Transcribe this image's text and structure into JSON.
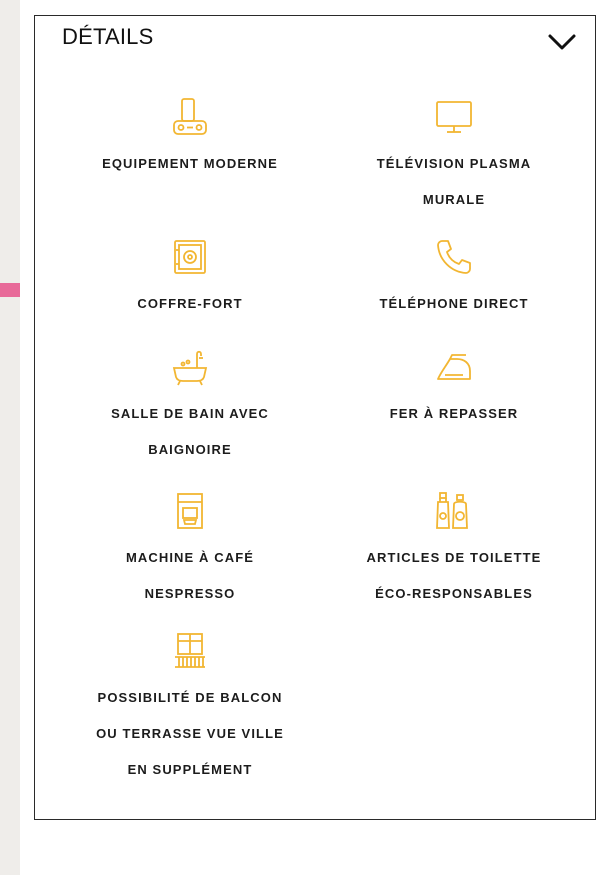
{
  "details": {
    "title": "DÉTAILS",
    "toggle_icon": "chevron-down-icon",
    "accent_color": "#f2b632",
    "marker_color": "#e86a99",
    "features": [
      {
        "icon": "speaker-dock-icon",
        "label": "EQUIPEMENT MODERNE"
      },
      {
        "icon": "tv-icon",
        "label": "TÉLÉVISION PLASMA\nMURALE"
      },
      {
        "icon": "safe-icon",
        "label": "COFFRE-FORT"
      },
      {
        "icon": "phone-icon",
        "label": "TÉLÉPHONE DIRECT"
      },
      {
        "icon": "bathtub-icon",
        "label": "SALLE DE BAIN AVEC\nBAIGNOIRE"
      },
      {
        "icon": "iron-icon",
        "label": "FER À REPASSER"
      },
      {
        "icon": "coffee-machine-icon",
        "label": "MACHINE À CAFÉ\nNESPRESSO"
      },
      {
        "icon": "toiletries-icon",
        "label": "ARTICLES DE TOILETTE\nÉCO-RESPONSABLES"
      },
      {
        "icon": "balcony-icon",
        "label": "POSSIBILITÉ DE BALCON\nOU TERRASSE VUE VILLE\nEN SUPPLÉMENT"
      }
    ]
  }
}
